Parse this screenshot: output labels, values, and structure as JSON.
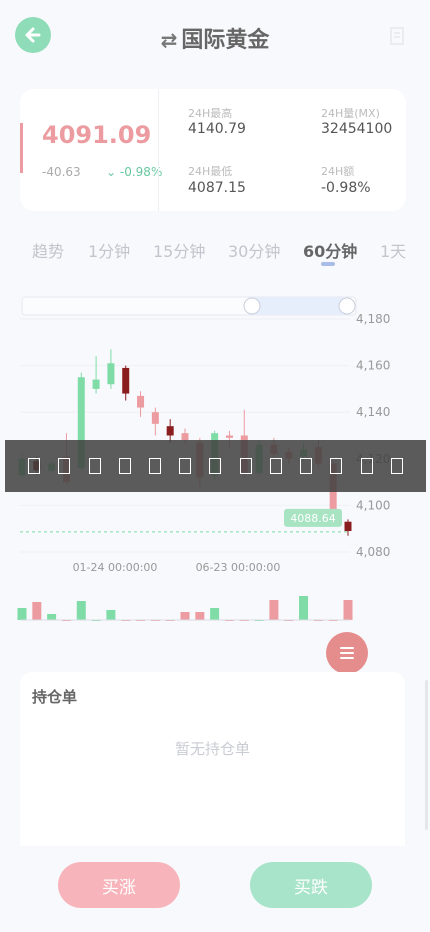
{
  "header": {
    "title": "国际黄金",
    "back_icon": "back-arrow-icon",
    "swap_icon": "swap-icon",
    "info_icon": "info-icon"
  },
  "quote": {
    "price": "4091.09",
    "change": "-40.63",
    "change_pct": "-0.98%",
    "stats": [
      {
        "label": "24H最高",
        "value": "4140.79"
      },
      {
        "label": "24H量(MX)",
        "value": "32454100"
      },
      {
        "label": "24H最低",
        "value": "4087.15"
      },
      {
        "label": "24H额",
        "value": "-0.98%"
      }
    ]
  },
  "tabs": [
    {
      "label": "趋势",
      "active": false
    },
    {
      "label": "1分钟",
      "active": false
    },
    {
      "label": "15分钟",
      "active": false
    },
    {
      "label": "30分钟",
      "active": false
    },
    {
      "label": "60分钟",
      "active": true
    },
    {
      "label": "1天",
      "active": false
    }
  ],
  "chart_data": {
    "type": "candlestick",
    "y_ticks": [
      "4,180",
      "4,160",
      "4,140",
      "4,120",
      "4,100",
      "4,080"
    ],
    "y_range": [
      4080,
      4180
    ],
    "x_labels": [
      "01-24 00:00:00",
      "06-23 00:00:00"
    ],
    "last_price_label": "4088.64",
    "last_price": 4088.64,
    "candles": [
      {
        "o": 4113,
        "c": 4120,
        "h": 4122,
        "l": 4112
      },
      {
        "o": 4119,
        "c": 4115,
        "h": 4121,
        "l": 4113
      },
      {
        "o": 4115,
        "c": 4118,
        "h": 4119,
        "l": 4114
      },
      {
        "o": 4121,
        "c": 4110,
        "h": 4131,
        "l": 4109
      },
      {
        "o": 4116,
        "c": 4155,
        "h": 4157,
        "l": 4115
      },
      {
        "o": 4150,
        "c": 4154,
        "h": 4164,
        "l": 4148
      },
      {
        "o": 4152,
        "c": 4161,
        "h": 4167,
        "l": 4150
      },
      {
        "o": 4159,
        "c": 4148,
        "h": 4160,
        "l": 4145
      },
      {
        "o": 4147,
        "c": 4142,
        "h": 4149,
        "l": 4138
      },
      {
        "o": 4140,
        "c": 4135,
        "h": 4142,
        "l": 4130
      },
      {
        "o": 4134,
        "c": 4130,
        "h": 4137,
        "l": 4127
      },
      {
        "o": 4131,
        "c": 4128,
        "h": 4133,
        "l": 4126
      },
      {
        "o": 4127,
        "c": 4112,
        "h": 4129,
        "l": 4108
      },
      {
        "o": 4113,
        "c": 4131,
        "h": 4132,
        "l": 4111
      },
      {
        "o": 4130,
        "c": 4129,
        "h": 4132,
        "l": 4125
      },
      {
        "o": 4130,
        "c": 4114,
        "h": 4141,
        "l": 4112
      },
      {
        "o": 4114,
        "c": 4126,
        "h": 4128,
        "l": 4113
      },
      {
        "o": 4126,
        "c": 4122,
        "h": 4129,
        "l": 4120
      },
      {
        "o": 4123,
        "c": 4120,
        "h": 4125,
        "l": 4118
      },
      {
        "o": 4121,
        "c": 4124,
        "h": 4127,
        "l": 4119
      },
      {
        "o": 4125,
        "c": 4118,
        "h": 4128,
        "l": 4116
      },
      {
        "o": 4118,
        "c": 4096,
        "h": 4119,
        "l": 4094
      },
      {
        "o": 4093,
        "c": 4089,
        "h": 4094,
        "l": 4087
      }
    ],
    "volumes": [
      12,
      18,
      6,
      0,
      19,
      0,
      10,
      0,
      0,
      0,
      0,
      8,
      8,
      12,
      0,
      0,
      0,
      20,
      0,
      24,
      0,
      0,
      20
    ],
    "colors": {
      "up": "#7fdca6",
      "down": "#ec9ca0",
      "down_dark": "#8a1e1e",
      "grid": "#eef0f4"
    }
  },
  "overlay": {
    "glyph_count": 13
  },
  "fab_icon": "menu-icon",
  "positions": {
    "title": "持仓单",
    "empty_text": "暂无持仓单"
  },
  "actions": {
    "buy_label": "买涨",
    "sell_label": "买跌"
  },
  "colors": {
    "accent_green": "#8fdcb8",
    "accent_red": "#ec9ca0",
    "buy_button": "#f7b5bb",
    "sell_button": "#a8e4c9"
  }
}
